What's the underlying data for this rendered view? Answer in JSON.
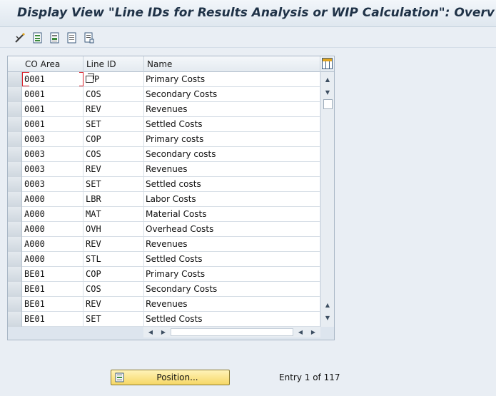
{
  "window": {
    "title": "Display View \"Line IDs for Results Analysis or WIP Calculation\": Overv"
  },
  "toolbar": {
    "buttons": [
      {
        "icon": "glasses-icon"
      },
      {
        "icon": "select-all-icon"
      },
      {
        "icon": "select-block-icon"
      },
      {
        "icon": "deselect-all-icon"
      },
      {
        "icon": "print-icon"
      }
    ]
  },
  "table": {
    "columns": [
      "CO Area",
      "Line ID",
      "Name"
    ],
    "rows": [
      {
        "co_area": "0001",
        "line_id": "COP",
        "name": "Primary Costs"
      },
      {
        "co_area": "0001",
        "line_id": "COS",
        "name": "Secondary Costs"
      },
      {
        "co_area": "0001",
        "line_id": "REV",
        "name": "Revenues"
      },
      {
        "co_area": "0001",
        "line_id": "SET",
        "name": "Settled Costs"
      },
      {
        "co_area": "0003",
        "line_id": "COP",
        "name": "Primary costs"
      },
      {
        "co_area": "0003",
        "line_id": "COS",
        "name": "Secondary costs"
      },
      {
        "co_area": "0003",
        "line_id": "REV",
        "name": "Revenues"
      },
      {
        "co_area": "0003",
        "line_id": "SET",
        "name": "Settled costs"
      },
      {
        "co_area": "A000",
        "line_id": "LBR",
        "name": "Labor Costs"
      },
      {
        "co_area": "A000",
        "line_id": "MAT",
        "name": "Material Costs"
      },
      {
        "co_area": "A000",
        "line_id": "OVH",
        "name": "Overhead Costs"
      },
      {
        "co_area": "A000",
        "line_id": "REV",
        "name": "Revenues"
      },
      {
        "co_area": "A000",
        "line_id": "STL",
        "name": "Settled Costs"
      },
      {
        "co_area": "BE01",
        "line_id": "COP",
        "name": "Primary Costs"
      },
      {
        "co_area": "BE01",
        "line_id": "COS",
        "name": "Secondary Costs"
      },
      {
        "co_area": "BE01",
        "line_id": "REV",
        "name": "Revenues"
      },
      {
        "co_area": "BE01",
        "line_id": "SET",
        "name": "Settled Costs"
      }
    ],
    "first_row_line_id_visible": "P"
  },
  "footer": {
    "position_button": "Position...",
    "entry_text": "Entry 1 of 117"
  },
  "colors": {
    "title": "#1f3247",
    "background": "#e9eef4",
    "position_button": "#f6d766",
    "cursor_marker": "#d9212b"
  }
}
